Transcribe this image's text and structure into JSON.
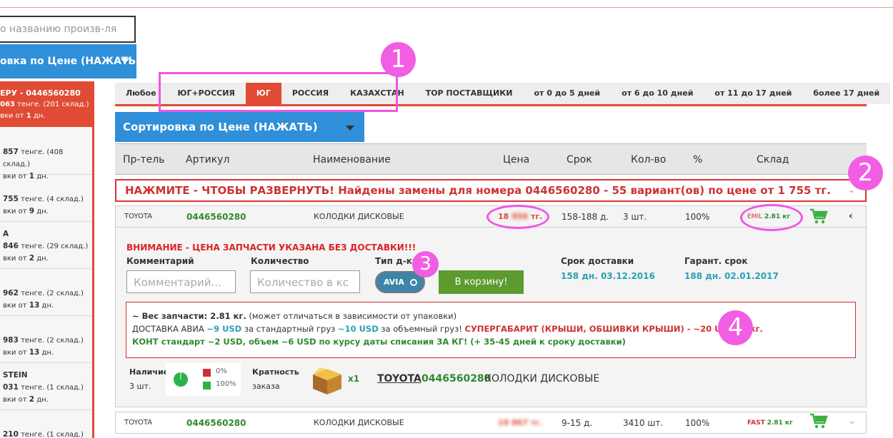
{
  "search": {
    "placeholder": "о названию произв-ля"
  },
  "sort_left": {
    "label": "овка по Цене (НАЖАТЬ)"
  },
  "sidebar": {
    "top": {
      "line1": "ЕРУ - 0446560280",
      "line2a": "063",
      "line2b": " тенге. (201 склад.)",
      "line3a": "вки от ",
      "line3b": "1",
      "line3c": " дн."
    },
    "items": [
      {
        "title": "",
        "price": "857",
        "stock": " тенге. (408 склад.)",
        "days": "1"
      },
      {
        "title": "",
        "price": "755",
        "stock": " тенге. (4 склад.)",
        "days": "9"
      },
      {
        "title": "A",
        "price": "846",
        "stock": " тенге. (29 склад.)",
        "days": "2"
      },
      {
        "title": "",
        "price": "962",
        "stock": " тенге. (2 склад.)",
        "days": "13"
      },
      {
        "title": "",
        "price": "983",
        "stock": " тенге. (2 склад.)",
        "days": "13"
      },
      {
        "title": "STEIN",
        "price": "031",
        "stock": " тенге. (1 склад.)",
        "days": "2"
      },
      {
        "title": "",
        "price": "210",
        "stock": " тенге. (1 склад.)",
        "days": ""
      }
    ],
    "days_prefix": "вки от ",
    "days_suffix": " дн."
  },
  "tabs": [
    "Любое",
    "ЮГ+РОССИЯ",
    "ЮГ",
    "РОССИЯ",
    "КАЗАХСТАН",
    "TOP ПОСТАВЩИКИ",
    "от 0 до 5 дней",
    "от 6 до 10 дней",
    "от 11 до 17 дней",
    "более 17 дней"
  ],
  "active_tab": "ЮГ",
  "sort_main": {
    "label": "Сортировка по Цене (НАЖАТЬ)"
  },
  "table_headers": {
    "supplier": "Пр-тель",
    "article": "Артикул",
    "name": "Наименование",
    "price": "Цена",
    "term": "Срок",
    "qty": "Кол-во",
    "pct": "%",
    "stock": "Склад"
  },
  "notice": "НАЖМИТЕ - ЧТОБЫ РАЗВЕРНУТЬ! Найдены замены для номера 0446560280 - 55 вариант(ов) по цене от 1 755 тг.",
  "row1": {
    "brand": "TOYOTA",
    "article": "0446560280",
    "name": "КОЛОДКИ ДИСКОВЫЕ",
    "price_a": "18",
    "price_b": "956",
    "price_c": " тг.",
    "term": "158-188 д.",
    "qty": "3 шт.",
    "pct": "100%",
    "stock_code": "EMIL",
    "weight": "2.81 кг"
  },
  "detail": {
    "warning": "ВНИМАНИЕ - ЦЕНА ЗАПЧАСТИ УКАЗАНА БЕЗ ДОСТАВКИ!!!",
    "comment_label": "Комментарий",
    "comment_placeholder": "Комментарий...",
    "qty_label": "Количество",
    "qty_placeholder": "Количество в кс",
    "type_label": "Тип д-ки",
    "type_value": "AVIA",
    "cart_button": "В корзину!",
    "delivery_label": "Срок доставки",
    "delivery_value": "158 дн. 03.12.2016",
    "guarantee_label": "Гарант. срок",
    "guarantee_value": "188 дн. 02.01.2017",
    "info_line1_b": "~ Вес запчасти: 2.81 кг.",
    "info_line1_n": " (может отличаться в зависимости от упаковки)",
    "info_line2_a": "ДОСТАВКА АВИА  ",
    "info_line2_b": "~9 USD",
    "info_line2_c": " за стандартный груз ",
    "info_line2_d": "~10 USD",
    "info_line2_e": " за объемный груз! ",
    "info_line2_f": "СУПЕРГАБАРИТ (КРЫШИ, ОБШИВКИ КРЫШИ) - ~20 USD за кг.",
    "info_line3": "КОНТ стандарт ~2 USD, объем ~6 USD по курсу даты списания ЗА КГ! (+ 35-45 дней к сроку доставки)",
    "avail_label": "Наличие",
    "avail_value": "3 шт.",
    "legend_a": "0%",
    "legend_b": "100%",
    "mult_label1": "Кратность",
    "mult_label2": "заказа",
    "mult_value": "x1",
    "brand_link": "TOYOTA",
    "article": "0446560280",
    "name": "КОЛОДКИ ДИСКОВЫЕ"
  },
  "row2": {
    "brand": "TOYOTA",
    "article": "0446560280",
    "name": "КОЛОДКИ ДИСКОВЫЕ",
    "price": "19 867 тг.",
    "term": "9-15 д.",
    "qty": "3410 шт.",
    "pct": "100%",
    "stock_code": "FAST",
    "weight": "2.81 кг"
  },
  "annotations": [
    "1",
    "2",
    "3",
    "4"
  ],
  "colors": {
    "accent_red": "#e04b35",
    "blue": "#2f8fd8",
    "green": "#5c9b30",
    "marker": "#f255e3"
  }
}
